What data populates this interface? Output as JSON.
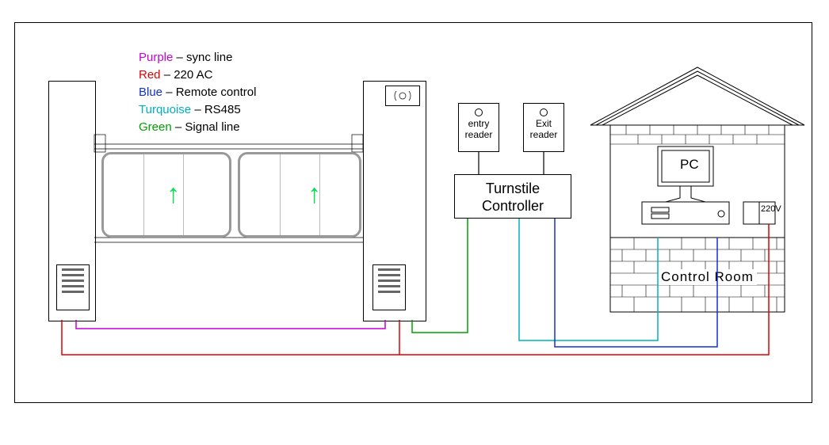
{
  "legend": {
    "items": [
      {
        "color_label": "Purple",
        "color": "purple",
        "sep": " – ",
        "desc": "sync line"
      },
      {
        "color_label": "Red",
        "color": "red",
        "sep": " – ",
        "desc": "220 AC"
      },
      {
        "color_label": "Blue",
        "color": "blue",
        "sep": " – ",
        "desc": "Remote control"
      },
      {
        "color_label": "Turquoise",
        "color": "turq",
        "sep": " – ",
        "desc": "RS485"
      },
      {
        "color_label": "Green",
        "color": "green",
        "sep": " – ",
        "desc": "Signal line"
      }
    ]
  },
  "readers": {
    "entry": {
      "line1": "entry",
      "line2": "reader"
    },
    "exit": {
      "line1": "Exit",
      "line2": "reader"
    }
  },
  "controller": {
    "line1": "Turnstile",
    "line2": "Controller"
  },
  "house": {
    "label": "Control Room",
    "pc": "PC",
    "outlet": "220V"
  },
  "wiring": {
    "colors": {
      "sync": "#c400d8",
      "power": "#e00000",
      "remote": "#1030d0",
      "rs485": "#00b0c0",
      "signal": "#00a000"
    }
  },
  "chart_data": {
    "type": "diagram",
    "title": "Turnstile wiring / connection diagram",
    "nodes": [
      {
        "id": "t_left",
        "label": "Turnstile (left post)"
      },
      {
        "id": "t_right",
        "label": "Turnstile (right post, RFID reader panel)"
      },
      {
        "id": "entry_reader",
        "label": "entry reader"
      },
      {
        "id": "exit_reader",
        "label": "Exit reader"
      },
      {
        "id": "controller",
        "label": "Turnstile Controller"
      },
      {
        "id": "control_room",
        "label": "Control Room (PC + 220V outlet)"
      }
    ],
    "edges": [
      {
        "from": "t_left",
        "to": "t_right",
        "line": "sync",
        "color": "Purple",
        "desc": "sync line"
      },
      {
        "from": "t_left",
        "to": "control_room",
        "line": "power",
        "color": "Red",
        "desc": "220 AC"
      },
      {
        "from": "t_right",
        "to": "control_room",
        "line": "power",
        "color": "Red",
        "desc": "220 AC"
      },
      {
        "from": "entry_reader",
        "to": "controller",
        "line": "data",
        "color": "Black"
      },
      {
        "from": "exit_reader",
        "to": "controller",
        "line": "data",
        "color": "Black"
      },
      {
        "from": "controller",
        "to": "t_right",
        "line": "signal",
        "color": "Green",
        "desc": "Signal line"
      },
      {
        "from": "controller",
        "to": "control_room",
        "line": "rs485",
        "color": "Turquoise",
        "desc": "RS485"
      },
      {
        "from": "controller",
        "to": "control_room",
        "line": "remote",
        "color": "Blue",
        "desc": "Remote control"
      }
    ],
    "legend": [
      {
        "color": "Purple",
        "meaning": "sync line"
      },
      {
        "color": "Red",
        "meaning": "220 AC"
      },
      {
        "color": "Blue",
        "meaning": "Remote control"
      },
      {
        "color": "Turquoise",
        "meaning": "RS485"
      },
      {
        "color": "Green",
        "meaning": "Signal line"
      }
    ]
  }
}
